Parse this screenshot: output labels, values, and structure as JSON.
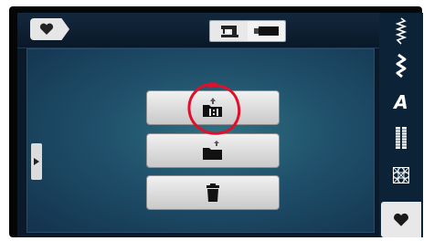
{
  "header": {
    "favorites_icon": "heart-icon",
    "mode_toggle": {
      "left_icon": "sewing-machine-icon",
      "right_icon": "usb-stick-icon",
      "selected": "sewing-machine"
    }
  },
  "side_handle": {
    "icon": "chevron-right-icon"
  },
  "menu": {
    "buttons": [
      {
        "icon": "folder-import-icon"
      },
      {
        "icon": "folder-export-icon"
      },
      {
        "icon": "trash-icon"
      }
    ]
  },
  "annotation": {
    "color": "#e0102a",
    "shape": "hand-drawn circle around first button icon"
  },
  "rightbar": {
    "items": [
      {
        "icon": "zigzag-stitch-icon"
      },
      {
        "icon": "decorative-stitch-icon"
      },
      {
        "icon": "alphabet-icon",
        "label": "A"
      },
      {
        "icon": "buttonhole-icon"
      },
      {
        "icon": "quilt-pattern-icon"
      },
      {
        "icon": "heart-icon",
        "active": true
      }
    ]
  },
  "colors": {
    "accent": "#e0102a",
    "panel_bg": "#1f4f6a",
    "button_bg": "#e0e0e0"
  }
}
